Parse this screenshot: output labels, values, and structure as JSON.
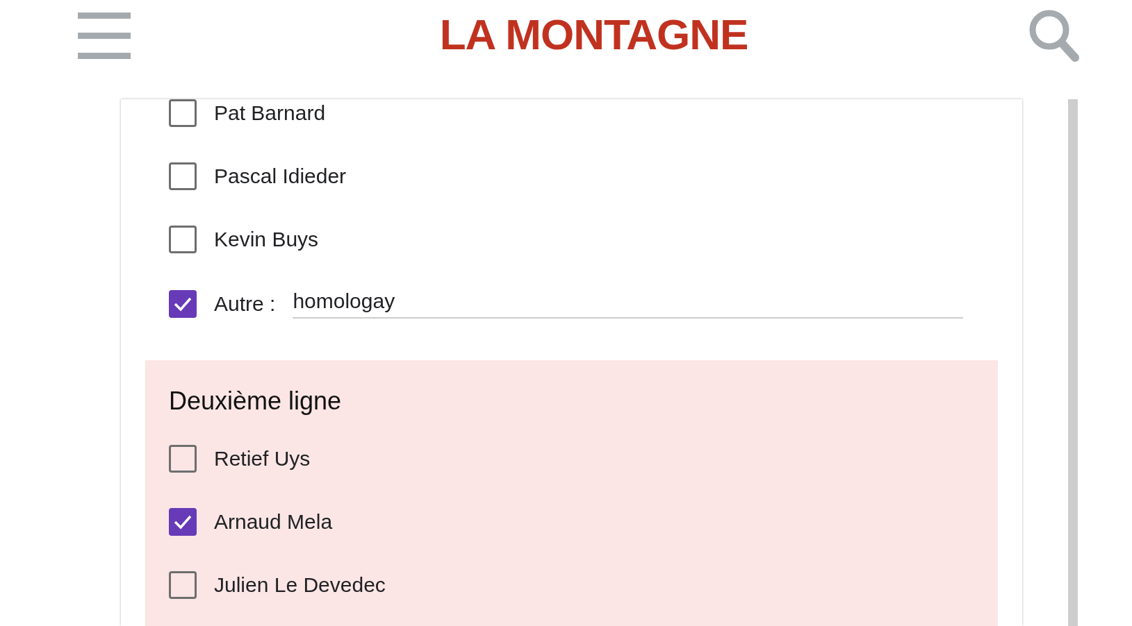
{
  "header": {
    "logo": "LA MONTAGNE"
  },
  "first_group": {
    "options": [
      {
        "label": "Pat Barnard",
        "checked": false
      },
      {
        "label": "Pascal Idieder",
        "checked": false
      },
      {
        "label": "Kevin Buys",
        "checked": false
      }
    ],
    "other": {
      "label": "Autre :",
      "checked": true,
      "value": "homologay"
    }
  },
  "second_group": {
    "title": "Deuxième ligne",
    "options": [
      {
        "label": "Retief Uys",
        "checked": false
      },
      {
        "label": "Arnaud Mela",
        "checked": true
      },
      {
        "label": "Julien Le Devedec",
        "checked": false
      }
    ]
  }
}
